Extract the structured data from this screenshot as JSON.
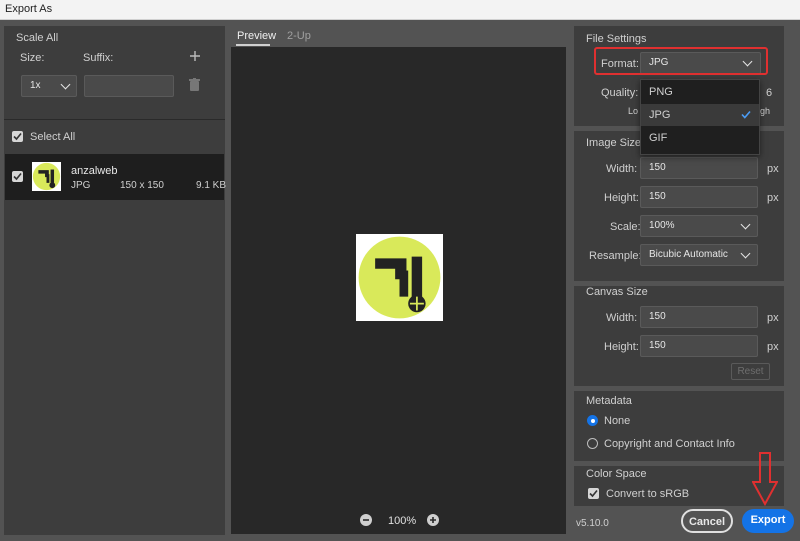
{
  "window": {
    "title": "Export As"
  },
  "left": {
    "scale_all": "Scale All",
    "size_label": "Size:",
    "suffix_label": "Suffix:",
    "size_value": "1x",
    "suffix_value": "",
    "select_all": "Select All",
    "asset": {
      "name": "anzalweb",
      "format": "JPG",
      "dimensions": "150 x 150",
      "filesize": "9.1 KB"
    }
  },
  "center": {
    "tabs": [
      "Preview",
      "2-Up"
    ],
    "zoom": "100%",
    "icons": {
      "zoom_out": "minus-circle-icon",
      "zoom_in": "plus-circle-icon"
    }
  },
  "file_settings": {
    "heading": "File Settings",
    "format_label": "Format:",
    "format_value": "JPG",
    "quality_label": "Quality:",
    "quality_value_fragment": "6",
    "quality_low_fragment": "Lo",
    "quality_high_fragment": "gh",
    "format_options": [
      "PNG",
      "JPG",
      "GIF"
    ],
    "selected_option": "JPG"
  },
  "image_size": {
    "heading": "Image Size",
    "width_label": "Width:",
    "width_value": "150",
    "height_label": "Height:",
    "height_value": "150",
    "scale_label": "Scale:",
    "scale_value": "100%",
    "resample_label": "Resample:",
    "resample_value": "Bicubic Automatic",
    "unit": "px"
  },
  "canvas_size": {
    "heading": "Canvas Size",
    "width_label": "Width:",
    "width_value": "150",
    "height_label": "Height:",
    "height_value": "150",
    "unit": "px",
    "reset": "Reset"
  },
  "metadata": {
    "heading": "Metadata",
    "options": [
      "None",
      "Copyright and Contact Info"
    ],
    "selected": "None"
  },
  "color_space": {
    "heading": "Color Space",
    "convert": "Convert to sRGB"
  },
  "footer": {
    "version": "v5.10.0",
    "cancel": "Cancel",
    "export": "Export"
  },
  "colors": {
    "accent": "#1473e6",
    "highlight": "#e03030",
    "logo_green": "#d9e95a"
  }
}
